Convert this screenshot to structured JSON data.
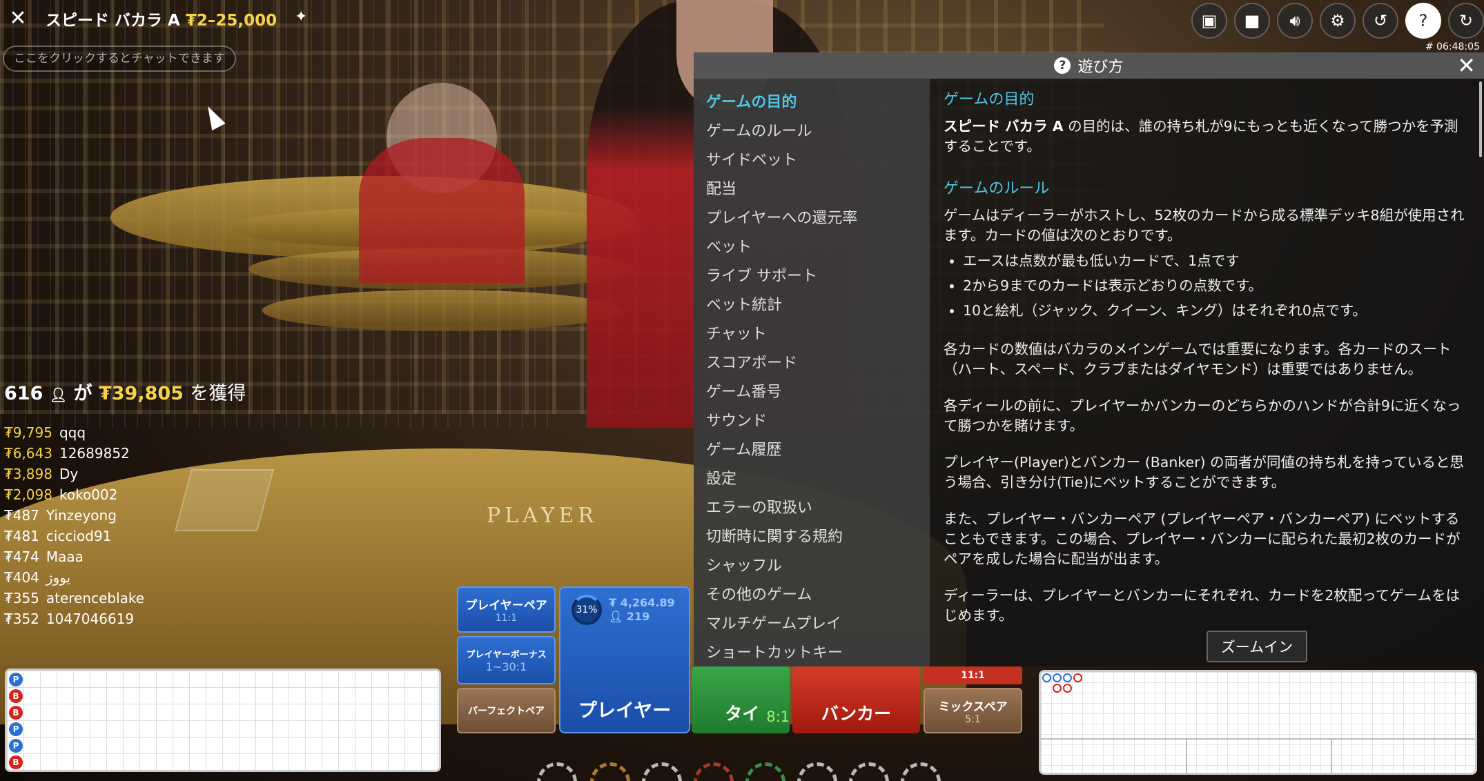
{
  "header": {
    "title": "スピード バカラ A ",
    "limits": "₮2–25,000",
    "game_id": "# 06:48:05",
    "chat_placeholder": "ここをクリックするとチャットできます"
  },
  "toolbar_icons": [
    "chat-icon",
    "video-icon",
    "volume-icon",
    "settings-icon",
    "history-icon",
    "help-icon",
    "reconnect-icon"
  ],
  "winners": {
    "count": "616",
    "verb": "が",
    "amount": "₮39,805",
    "suffix": "を獲得",
    "list": [
      {
        "amount": "₮9,795",
        "name": "qqq"
      },
      {
        "amount": "₮6,643",
        "name": "12689852"
      },
      {
        "amount": "₮3,898",
        "name": "Dy"
      },
      {
        "amount": "₮2,098",
        "name": "koko002"
      },
      {
        "amount": "₮487",
        "name": "Yinzeyong"
      },
      {
        "amount": "₮481",
        "name": "cicciod91"
      },
      {
        "amount": "₮474",
        "name": "Maaa"
      },
      {
        "amount": "₮404",
        "name": "یووژ"
      },
      {
        "amount": "₮355",
        "name": "aterenceblake"
      },
      {
        "amount": "₮352",
        "name": "1047046619"
      }
    ]
  },
  "table_label": "PLAYER",
  "help": {
    "title": "遊び方",
    "nav": [
      "ゲームの目的",
      "ゲームのルール",
      "サイドベット",
      "配当",
      "プレイヤーへの還元率",
      "ベット",
      "ライブ サポート",
      "ベット統計",
      "チャット",
      "スコアボード",
      "ゲーム番号",
      "サウンド",
      "ゲーム履歴",
      "設定",
      "エラーの取扱い",
      "切断時に関する規約",
      "シャッフル",
      "その他のゲーム",
      "マルチゲームプレイ",
      "ショートカットキー"
    ],
    "h_objective": "ゲームの目的",
    "objective_bold": "スピード バカラ A",
    "objective_text": " の目的は、誰の持ち札が9にもっとも近くなって勝つかを予測することです。",
    "h_rules": "ゲームのルール",
    "rules_intro": "ゲームはディーラーがホストし、52枚のカードから成る標準デッキ8組が使用されます。カードの値は次のとおりです。",
    "rules_list": [
      "エースは点数が最も低いカードで、1点です",
      "2から9までのカードは表示どおりの点数です。",
      "10と絵札（ジャック、クイーン、キング）はそれぞれ0点です。"
    ],
    "p_suits": "各カードの数値はバカラのメインゲームでは重要になります。各カードのスート（ハート、スペード、クラブまたはダイヤモンド）は重要ではありません。",
    "p_bet": "各ディールの前に、プレイヤーかバンカーのどちらかのハンドが合計9に近くなって勝つかを賭けます。",
    "p_tie": "プレイヤー(Player)とバンカー (Banker) の両者が同値の持ち札を持っていると思う場合、引き分け(Tie)にベットすることができます。",
    "p_pair": "また、プレイヤー・バンカーペア (プレイヤーペア・バンカーペア) にベットすることもできます。この場合、プレイヤー・バンカーに配られた最初2枚のカードがペアを成した場合に配当が出ます。",
    "p_deal": "ディーラーは、プレイヤーとバンカーにそれぞれ、カードを2枚配ってゲームをはじめます。"
  },
  "bets": {
    "player_pair": {
      "label": "プレイヤーペア",
      "odds": "11:1"
    },
    "player_bonus": {
      "label": "プレイヤーボーナス",
      "odds": "1~30:1"
    },
    "perfect_pair": {
      "label": "パーフェクトペア"
    },
    "player": {
      "label": "プレイヤー",
      "pct": "31%",
      "amount": "₮ 4,264.89",
      "players": "219"
    },
    "tie": {
      "label": "タイ",
      "odds": "8:1"
    },
    "banker": {
      "label": "バンカー"
    },
    "banker_pair_odds": "11:1",
    "mix_pair": {
      "label": "ミックスペア",
      "odds": "5:1"
    }
  },
  "roads": {
    "bead_left": [
      "P",
      "B",
      "B",
      "P",
      "P",
      "B"
    ],
    "big_road_top": [
      "P",
      "P",
      "P",
      "B",
      "B",
      "P"
    ]
  },
  "zoom_label": "ズームイン"
}
